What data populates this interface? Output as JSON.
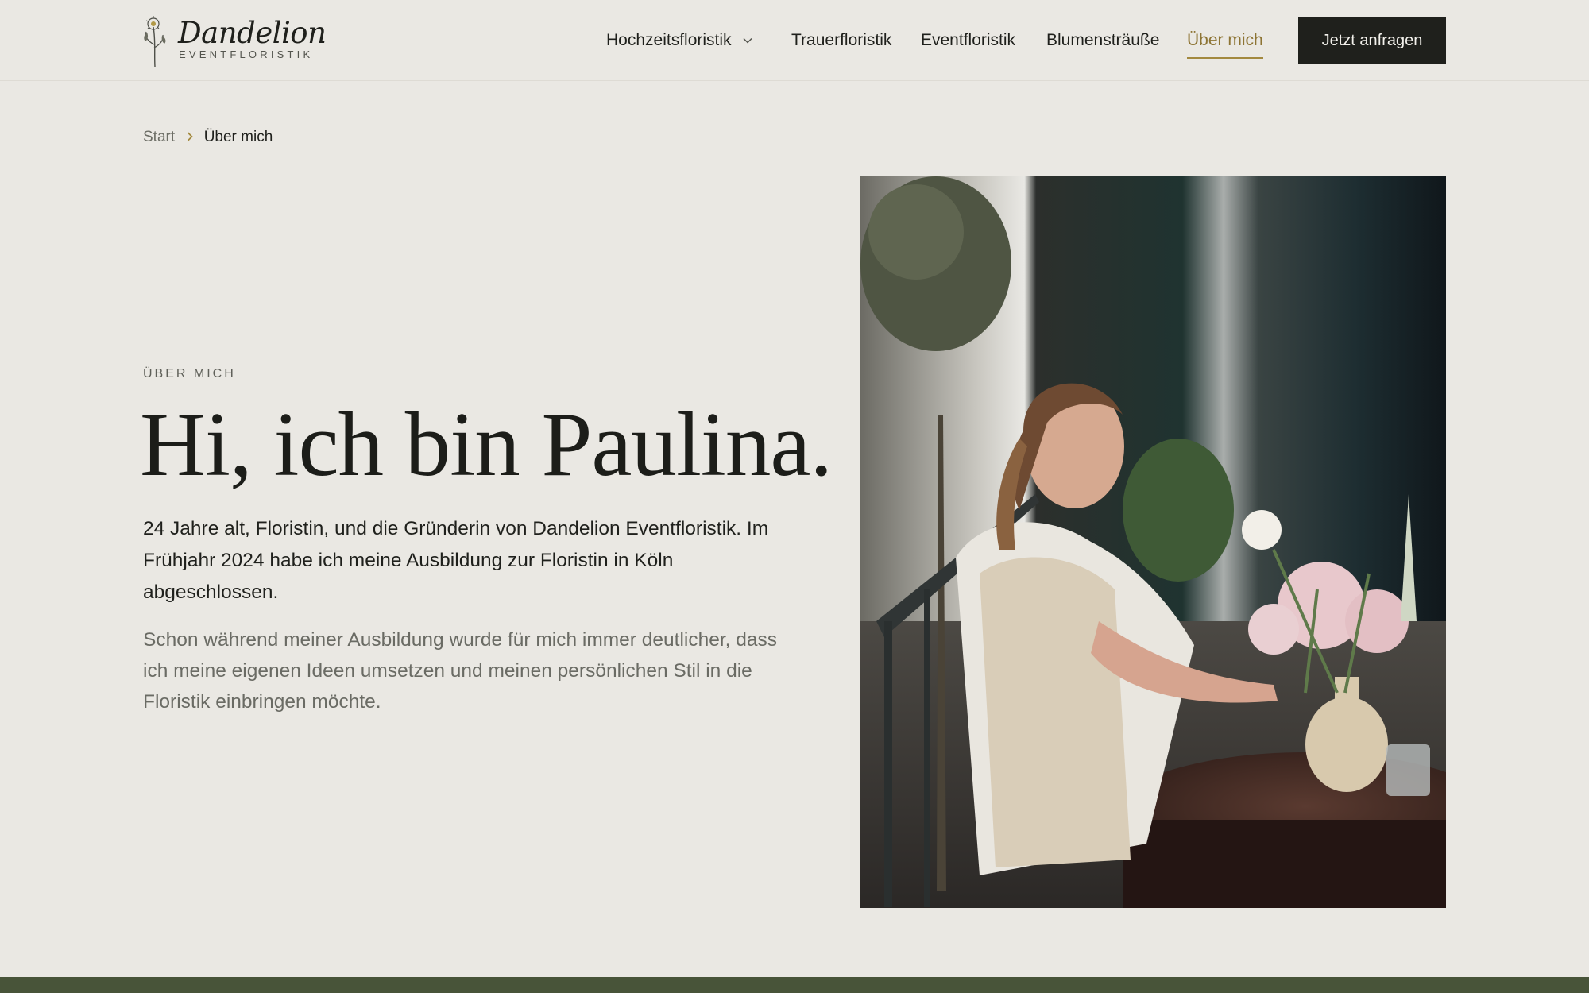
{
  "brand": {
    "name": "Dandelion",
    "tagline": "EVENTFLORISTIK",
    "logo_icon": "dandelion-flower-icon"
  },
  "nav": {
    "items": [
      {
        "label": "Hochzeitsfloristik",
        "has_dropdown": true,
        "active": false
      },
      {
        "label": "Trauerfloristik",
        "active": false
      },
      {
        "label": "Eventfloristik",
        "active": false
      },
      {
        "label": "Blumensträuße",
        "active": false
      },
      {
        "label": "Über mich",
        "active": true
      }
    ],
    "cta_label": "Jetzt anfragen"
  },
  "breadcrumb": {
    "items": [
      "Start",
      "Über mich"
    ],
    "separator_icon": "chevron-right-icon"
  },
  "hero": {
    "eyebrow": "ÜBER MICH",
    "title": "Hi, ich bin Paulina.",
    "intro": "24 Jahre alt, Floristin, und die Gründerin von Dandelion Eventfloristik. Im Frühjahr 2024 habe ich meine Ausbildung zur Floristin in Köln abgeschlossen.",
    "body": "Schon während meiner Ausbildung wurde für mich immer deutlicher, dass ich meine eigenen Ideen umsetzen und meinen persönlichen Stil in die Floristik einbringen möchte."
  },
  "colors": {
    "background": "#eae8e3",
    "text": "#1f201c",
    "muted_text": "#6a6b64",
    "accent_gold": "#8d7434",
    "button_bg": "#1f201c",
    "footer_green": "#485439"
  }
}
